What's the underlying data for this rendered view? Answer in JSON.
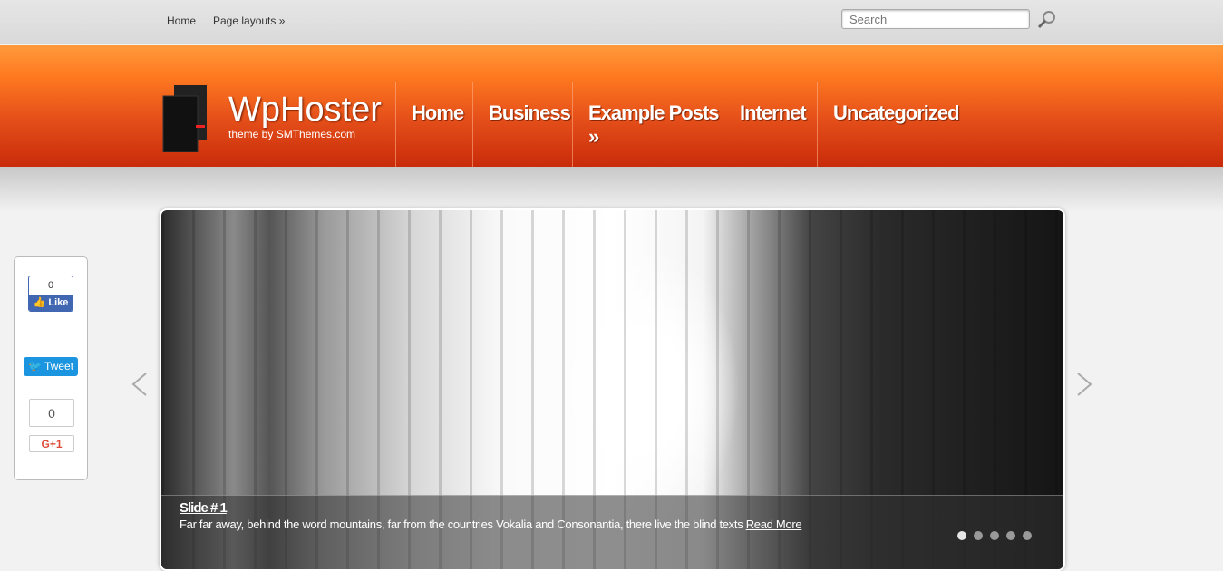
{
  "topbar": {
    "links": [
      "Home",
      "Page layouts »"
    ],
    "search_placeholder": "Search"
  },
  "header": {
    "title": "WpHoster",
    "tagline": "theme by SMThemes.com",
    "nav": [
      "Home",
      "Business",
      "Example Posts »",
      "Internet",
      "Uncategorized"
    ]
  },
  "slider": {
    "slide_title": "Slide # 1",
    "slide_text": "Far far away, behind the word mountains, far from the countries Vokalia and Consonantia, there live the blind texts",
    "read_more": "Read More",
    "dots": 5,
    "active_dot": 1
  },
  "share": {
    "fb_count": "0",
    "fb_label": "Like",
    "tweet_label": "Tweet",
    "gplus_count": "0",
    "gplus_label": "G+1"
  },
  "colors": {
    "header_orange": "#e5501a",
    "facebook": "#4267b2",
    "twitter": "#1b95e0",
    "gplus": "#dd4b39"
  }
}
